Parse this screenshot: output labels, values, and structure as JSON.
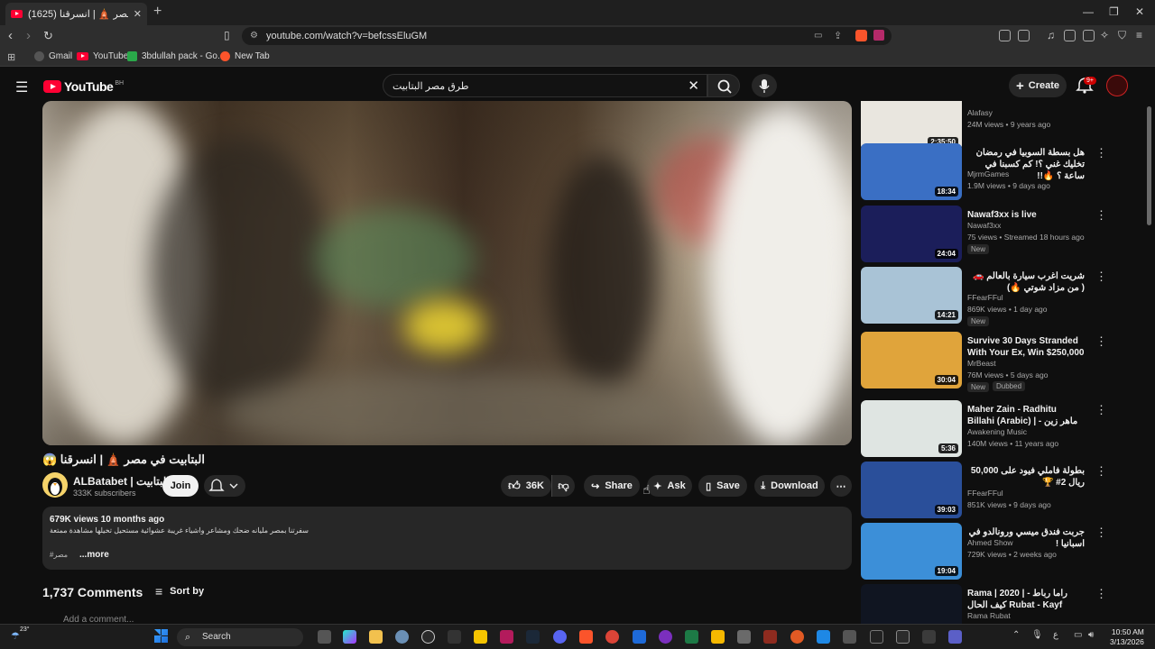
{
  "browser": {
    "tab_title": "(1625) البتابيت في مصر 🛕 | انسرقنا",
    "url": "youtube.com/watch?v=befcssEluGM",
    "bookmarks": [
      "Gmail",
      "YouTube",
      "3bdullah pack - Go...",
      "New Tab"
    ]
  },
  "youtube": {
    "logo": "YouTube",
    "country": "BH",
    "search_query": "طرق مصر البتابيت",
    "create_label": "Create",
    "notif_badge": "9+"
  },
  "video": {
    "title": "البتابيت في مصر 🛕 | انسرقنا 😱",
    "channel": "ALBatabet | البتابيت",
    "subscribers": "333K subscribers",
    "join_label": "Join",
    "likes": "36K",
    "share_label": "Share",
    "ask_label": "Ask",
    "save_label": "Save",
    "download_label": "Download",
    "views_date": "679K views  10 months ago",
    "description": "سفرتنا بمصر مليانه ضحك ومشاعر واشياء غريبة عشوائية مستحيل تخيلها مشاهدة ممتعة",
    "hashtag": "#مصر",
    "more_label": "...more",
    "comments_count": "1,737 Comments",
    "sort_label": "Sort by",
    "add_comment": "Add a comment..."
  },
  "recommendations": [
    {
      "title": "",
      "channel": "Alafasy",
      "meta": "24M views • 9 years ago",
      "duration": "2:35:50",
      "badge": "",
      "thumb": "#e9e6df"
    },
    {
      "title": "هل بسطة السوبيا في رمضان تخليك غني ؟! كم كسبنا في ساعة ؟ 🔥!!",
      "channel": "MjrmGames",
      "meta": "1.9M views • 9 days ago",
      "duration": "18:34",
      "badge": "",
      "thumb": "#3a6fc4"
    },
    {
      "title": "Nawaf3xx is live",
      "channel": "Nawaf3xx",
      "meta": "75 views • Streamed 18 hours ago",
      "duration": "24:04",
      "badge": "New",
      "thumb": "#1b1e5a"
    },
    {
      "title": "شريت اغرب سيارة بالعالم 🚗 ( من مزاد شوتي 🔥)",
      "channel": "FFearFFul",
      "meta": "869K views • 1 day ago",
      "duration": "14:21",
      "badge": "New",
      "thumb": "#a9c3d6"
    },
    {
      "title": "Survive 30 Days Stranded With Your Ex, Win $250,000",
      "channel": "MrBeast",
      "meta": "76M views • 5 days ago",
      "duration": "30:04",
      "badge": "New",
      "badge2": "Dubbed",
      "thumb": "#e0a43b"
    },
    {
      "title": "Maher Zain - Radhitu Billahi (Arabic) | ماهر زين - رضيت بالله ربا | ...",
      "channel": "Awakening Music",
      "meta": "140M views • 11 years ago",
      "duration": "5:36",
      "badge": "",
      "thumb": "#dfe5e2"
    },
    {
      "title": "بطولة فاملي فيود على 50,000 ريال 2# 🏆",
      "channel": "FFearFFul",
      "meta": "851K views • 9 days ago",
      "duration": "39:03",
      "badge": "",
      "thumb": "#2a4f9a"
    },
    {
      "title": "جربت فندق ميسي ورونالدو في اسبانيا !",
      "channel": "Ahmed Show",
      "meta": "729K views • 2 weeks ago",
      "duration": "19:04",
      "badge": "",
      "thumb": "#3c8fd8"
    },
    {
      "title": "Rama | 2020 | راما رباط - كيف الحال Rubat - Kayf Alhal",
      "channel": "Rama Rubat",
      "meta": "",
      "duration": "",
      "badge": "",
      "thumb": "#101521"
    }
  ],
  "taskbar": {
    "weather": "23°",
    "search": "Search",
    "time": "10:50 AM",
    "date": "3/13/2026"
  }
}
